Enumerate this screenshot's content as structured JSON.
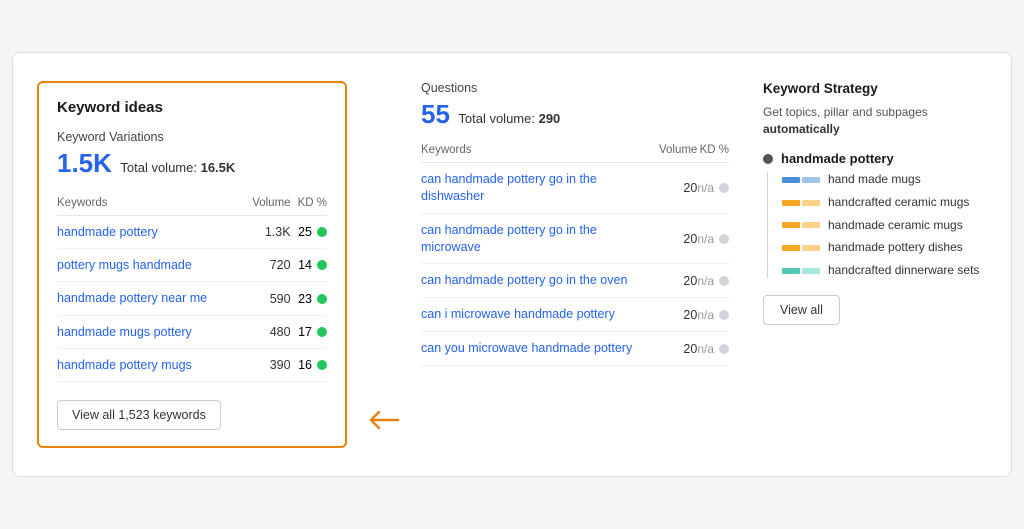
{
  "left": {
    "title": "Keyword ideas",
    "variations_label": "Keyword Variations",
    "big_number": "1.5K",
    "total_label": "Total volume:",
    "total_value": "16.5K",
    "table": {
      "col_keywords": "Keywords",
      "col_volume": "Volume",
      "col_kd": "KD %",
      "rows": [
        {
          "kw": "handmade pottery",
          "volume": "1.3K",
          "kd": "25"
        },
        {
          "kw": "pottery mugs handmade",
          "volume": "720",
          "kd": "14"
        },
        {
          "kw": "handmade pottery near me",
          "volume": "590",
          "kd": "23"
        },
        {
          "kw": "handmade mugs pottery",
          "volume": "480",
          "kd": "17"
        },
        {
          "kw": "handmade pottery mugs",
          "volume": "390",
          "kd": "16"
        }
      ]
    },
    "view_all_btn": "View all 1,523 keywords"
  },
  "middle": {
    "section_label": "Questions",
    "big_number": "55",
    "total_label": "Total volume:",
    "total_value": "290",
    "table": {
      "col_keywords": "Keywords",
      "col_volume": "Volume",
      "col_kd": "KD %",
      "rows": [
        {
          "kw": "can handmade pottery go in the dishwasher",
          "volume": "20",
          "kd": "n/a"
        },
        {
          "kw": "can handmade pottery go in the microwave",
          "volume": "20",
          "kd": "n/a"
        },
        {
          "kw": "can handmade pottery go in the oven",
          "volume": "20",
          "kd": "n/a"
        },
        {
          "kw": "can i microwave handmade pottery",
          "volume": "20",
          "kd": "n/a"
        },
        {
          "kw": "can you microwave handmade pottery",
          "volume": "20",
          "kd": "n/a"
        }
      ]
    }
  },
  "right": {
    "title": "Keyword Strategy",
    "subtitle_plain": "Get topics, pillar and subpages ",
    "subtitle_bold": "automatically",
    "pillar": {
      "label": "handmade pottery",
      "color": "#888"
    },
    "sub_items": [
      {
        "label": "hand made mugs",
        "color1": "#4a90d9",
        "color2": "#a0c4e8"
      },
      {
        "label": "handcrafted ceramic mugs",
        "color1": "#f5a623",
        "color2": "#fad28a"
      },
      {
        "label": "handmade ceramic mugs",
        "color1": "#f5a623",
        "color2": "#fad28a"
      },
      {
        "label": "handmade pottery dishes",
        "color1": "#f5a623",
        "color2": "#fad28a"
      },
      {
        "label": "handcrafted dinnerware sets",
        "color1": "#50c8b8",
        "color2": "#a8e6df"
      }
    ],
    "view_all_btn": "View all"
  }
}
